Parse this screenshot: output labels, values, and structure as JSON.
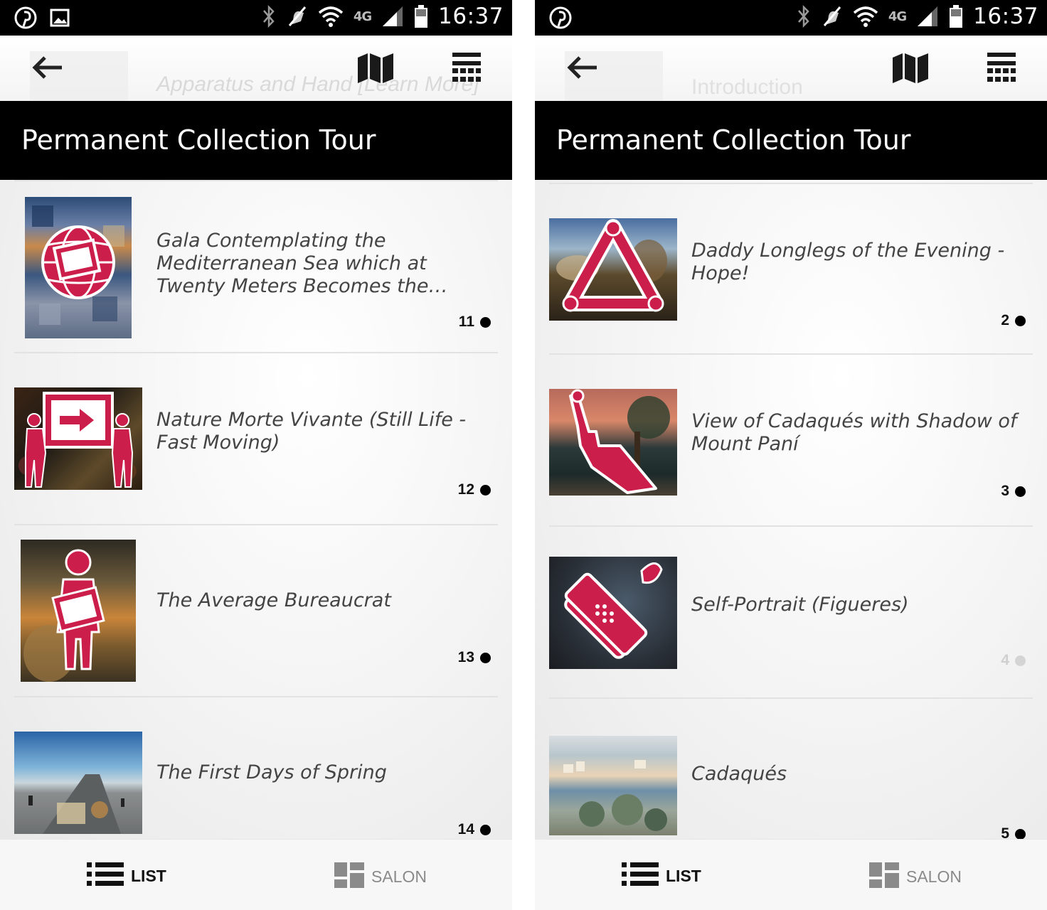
{
  "accent_color": "#cc1e4a",
  "status_bar": {
    "clock": "16:37",
    "network": "4G",
    "left_icons": [
      "pinterest-icon",
      "image-icon"
    ],
    "right_icons": [
      "bluetooth-icon",
      "vibrate-off-icon",
      "wifi-icon",
      "signal-icon",
      "battery-icon"
    ]
  },
  "screens": [
    {
      "toolbar": {
        "ghost_title": "Apparatus and Hand [Learn More]"
      },
      "title": "Permanent Collection Tour",
      "items": [
        {
          "title": "Gala Contemplating the Mediterranean Sea which at Twenty Meters Becomes the…",
          "stop": "11",
          "active": true,
          "badge_icon": "globe-screen-icon"
        },
        {
          "title": "Nature Morte Vivante (Still Life - Fast Moving)",
          "stop": "12",
          "active": true,
          "badge_icon": "people-carrying-sign-icon"
        },
        {
          "title": "The Average Bureaucrat",
          "stop": "13",
          "active": true,
          "badge_icon": "person-holding-paper-icon"
        },
        {
          "title": "The First Days of Spring",
          "stop": "14",
          "active": true,
          "badge_icon": "none"
        }
      ],
      "tabs": {
        "list": "LIST",
        "salon": "SALON"
      }
    },
    {
      "toolbar": {
        "ghost_title": "Introduction"
      },
      "title": "Permanent Collection Tour",
      "items": [
        {
          "title": "Daddy Longlegs of the Evening - Hope!",
          "stop": "2",
          "active": true,
          "badge_icon": "triangle-connector-icon"
        },
        {
          "title": "View of Cadaqués with Shadow of Mount Paní",
          "stop": "3",
          "active": true,
          "badge_icon": "pointing-hand-icon"
        },
        {
          "title": "Self-Portrait (Figueres)",
          "stop": "4",
          "active": false,
          "badge_icon": "brush-bandage-icon"
        },
        {
          "title": "Cadaqués",
          "stop": "5",
          "active": true,
          "badge_icon": "none"
        }
      ],
      "tabs": {
        "list": "LIST",
        "salon": "SALON"
      }
    }
  ]
}
